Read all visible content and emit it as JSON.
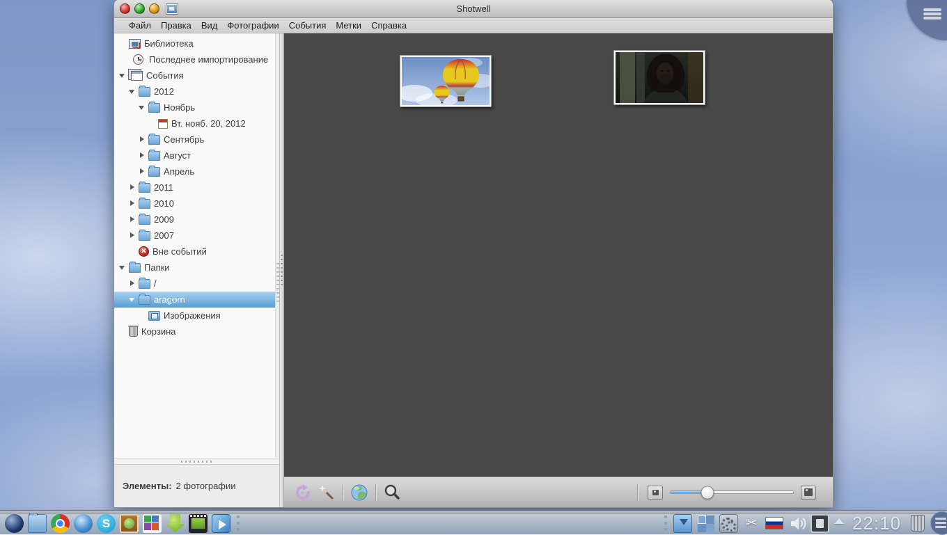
{
  "window": {
    "title": "Shotwell"
  },
  "titlebar_buttons": [
    "close",
    "maximize",
    "minimize"
  ],
  "menubar": {
    "items": [
      "Файл",
      "Правка",
      "Вид",
      "Фотографии",
      "События",
      "Метки",
      "Справка"
    ]
  },
  "sidebar": {
    "items": [
      {
        "label": "Библиотека",
        "icon": "library-icon"
      },
      {
        "label": "Последнее импортирование",
        "icon": "clock-icon"
      },
      {
        "label": "События",
        "icon": "events-icon",
        "expanded": true
      },
      {
        "label": "2012",
        "icon": "folder-icon",
        "expanded": true
      },
      {
        "label": "Ноябрь",
        "icon": "folder-icon",
        "expanded": true
      },
      {
        "label": "Вт. нояб. 20, 2012",
        "icon": "event-icon"
      },
      {
        "label": "Сентябрь",
        "icon": "folder-icon",
        "expanded": false
      },
      {
        "label": "Август",
        "icon": "folder-icon",
        "expanded": false
      },
      {
        "label": "Апрель",
        "icon": "folder-icon",
        "expanded": false
      },
      {
        "label": "2011",
        "icon": "folder-icon",
        "expanded": false
      },
      {
        "label": "2010",
        "icon": "folder-icon",
        "expanded": false
      },
      {
        "label": "2009",
        "icon": "folder-icon",
        "expanded": false
      },
      {
        "label": "2007",
        "icon": "folder-icon",
        "expanded": false
      },
      {
        "label": "Вне событий",
        "icon": "no-events-icon"
      },
      {
        "label": "Папки",
        "icon": "folder-icon",
        "expanded": true
      },
      {
        "label": "/",
        "icon": "folder-icon",
        "expanded": false
      },
      {
        "label": "aragorn",
        "icon": "folder-icon",
        "expanded": true,
        "selected": true
      },
      {
        "label": "Изображения",
        "icon": "folder-images-icon"
      },
      {
        "label": "Корзина",
        "icon": "trash-icon"
      }
    ],
    "status_label": "Элементы:",
    "status_value": "2 фотографии"
  },
  "content": {
    "photos": [
      {
        "name": "balloons-photo"
      },
      {
        "name": "aragorn-photo"
      }
    ]
  },
  "toolbar": {
    "icons": [
      "rotate-icon",
      "enhance-wand-icon",
      "publish-globe-icon",
      "search-icon"
    ],
    "zoom_percent": 30
  },
  "taskbar": {
    "left_icons": [
      "launcher-sphere",
      "file-manager",
      "chrome-browser",
      "chromium-browser",
      "skype",
      "photo-book",
      "office-suite",
      "green-downloader",
      "video-editor",
      "media-player"
    ],
    "tray_icons": [
      "downloads-folder",
      "pager-grid",
      "system-settings-gears",
      "clipboard-scissors",
      "keyboard-layout-ru",
      "volume",
      "print-device",
      "tray-expander-arrow"
    ],
    "clock": "22:10"
  },
  "colors": {
    "selection_blue": "#5c9fd6",
    "content_bg": "#484848",
    "desktop_blue": "#8aa2d0",
    "slider_fill": "#5aa2dc"
  }
}
